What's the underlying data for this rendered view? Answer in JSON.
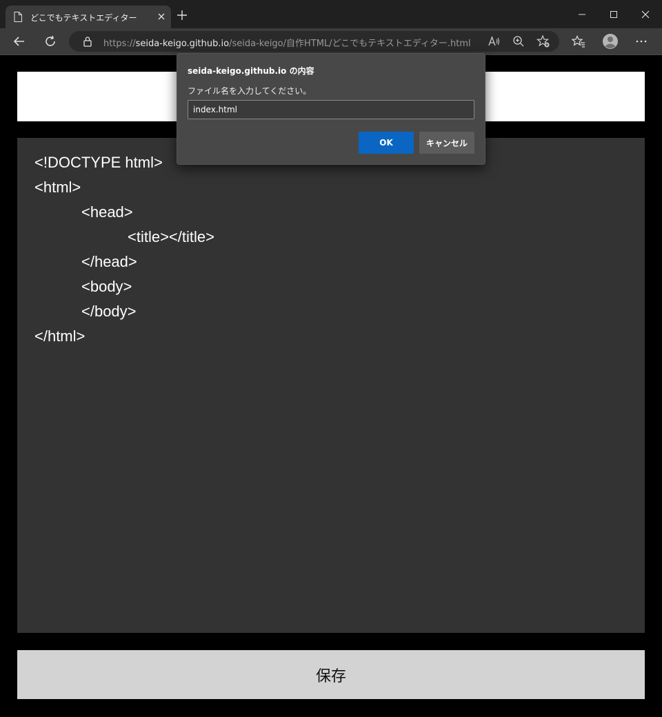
{
  "browser": {
    "tab_title": "どこでもテキストエディター",
    "url_scheme": "https://",
    "url_host": "seida-keigo.github.io",
    "url_path": "/seida-keigo/自作HTML/どこでもテキストエディター.html"
  },
  "page": {
    "filename_value": "",
    "code_lines": [
      {
        "text": "<!DOCTYPE html>",
        "indent": 0
      },
      {
        "text": "<html>",
        "indent": 0
      },
      {
        "text": "<head>",
        "indent": 1
      },
      {
        "text": "<title></title>",
        "indent": 2
      },
      {
        "text": "</head>",
        "indent": 1
      },
      {
        "text": "<body>",
        "indent": 1
      },
      {
        "text": "</body>",
        "indent": 1
      },
      {
        "text": "</html>",
        "indent": 0
      }
    ],
    "save_label": "保存"
  },
  "dialog": {
    "title": "seida-keigo.github.io の内容",
    "message": "ファイル名を入力してください。",
    "input_value": "index.html",
    "ok_label": "OK",
    "cancel_label": "キャンセル"
  },
  "colors": {
    "accent": "#0a66c2",
    "editor_bg": "#333333",
    "save_bg": "#d3d3d3"
  }
}
